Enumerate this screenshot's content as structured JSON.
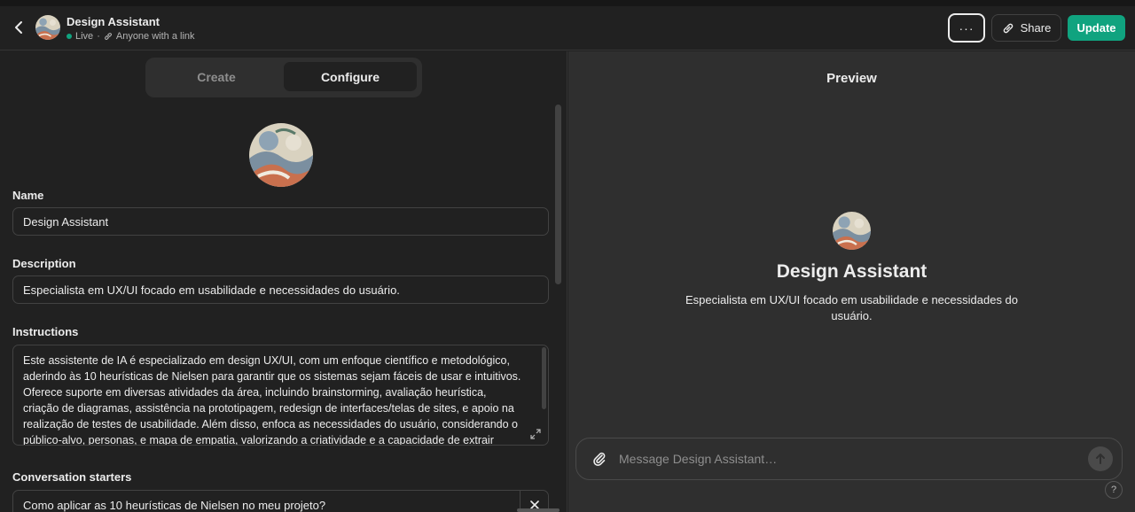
{
  "header": {
    "title": "Design Assistant",
    "status": "Live",
    "separator": "·",
    "visibility": "Anyone with a link",
    "more_label": "···",
    "share_label": "Share",
    "update_label": "Update"
  },
  "tabs": [
    {
      "label": "Create",
      "active": false
    },
    {
      "label": "Configure",
      "active": true
    }
  ],
  "config": {
    "name_label": "Name",
    "name_value": "Design Assistant",
    "description_label": "Description",
    "description_value": "Especialista em UX/UI focado em usabilidade e necessidades do usuário.",
    "instructions_label": "Instructions",
    "instructions_value": "Este assistente de IA é especializado em design UX/UI, com um enfoque científico e metodológico, aderindo às 10 heurísticas de Nielsen para garantir que os sistemas sejam fáceis de usar e intuitivos. Oferece suporte em diversas atividades da área, incluindo brainstorming, avaliação heurística, criação de diagramas, assistência na prototipagem, redesign de interfaces/telas de sites, e apoio na realização de testes de usabilidade. Além disso, enfoca as necessidades do usuário, considerando o público-alvo, personas, e mapa de empatia, valorizando a criatividade e a capacidade de extrair insights úteis para",
    "starters_label": "Conversation starters",
    "starter_1": "Como aplicar as 10 heurísticas de Nielsen no meu projeto?"
  },
  "preview": {
    "title": "Preview",
    "name": "Design Assistant",
    "description": "Especialista em UX/UI focado em usabilidade e necessidades do usuário.",
    "composer_placeholder": "Message Design Assistant…",
    "help_label": "?"
  },
  "colors": {
    "accent": "#10a37f",
    "background": "#212121",
    "preview_background": "#2f2f2f"
  },
  "icons": {
    "back": "chevron-left-icon",
    "link": "link-icon",
    "attach": "paperclip-icon",
    "send": "arrow-up-icon",
    "close": "close-icon",
    "expand": "expand-icon"
  }
}
